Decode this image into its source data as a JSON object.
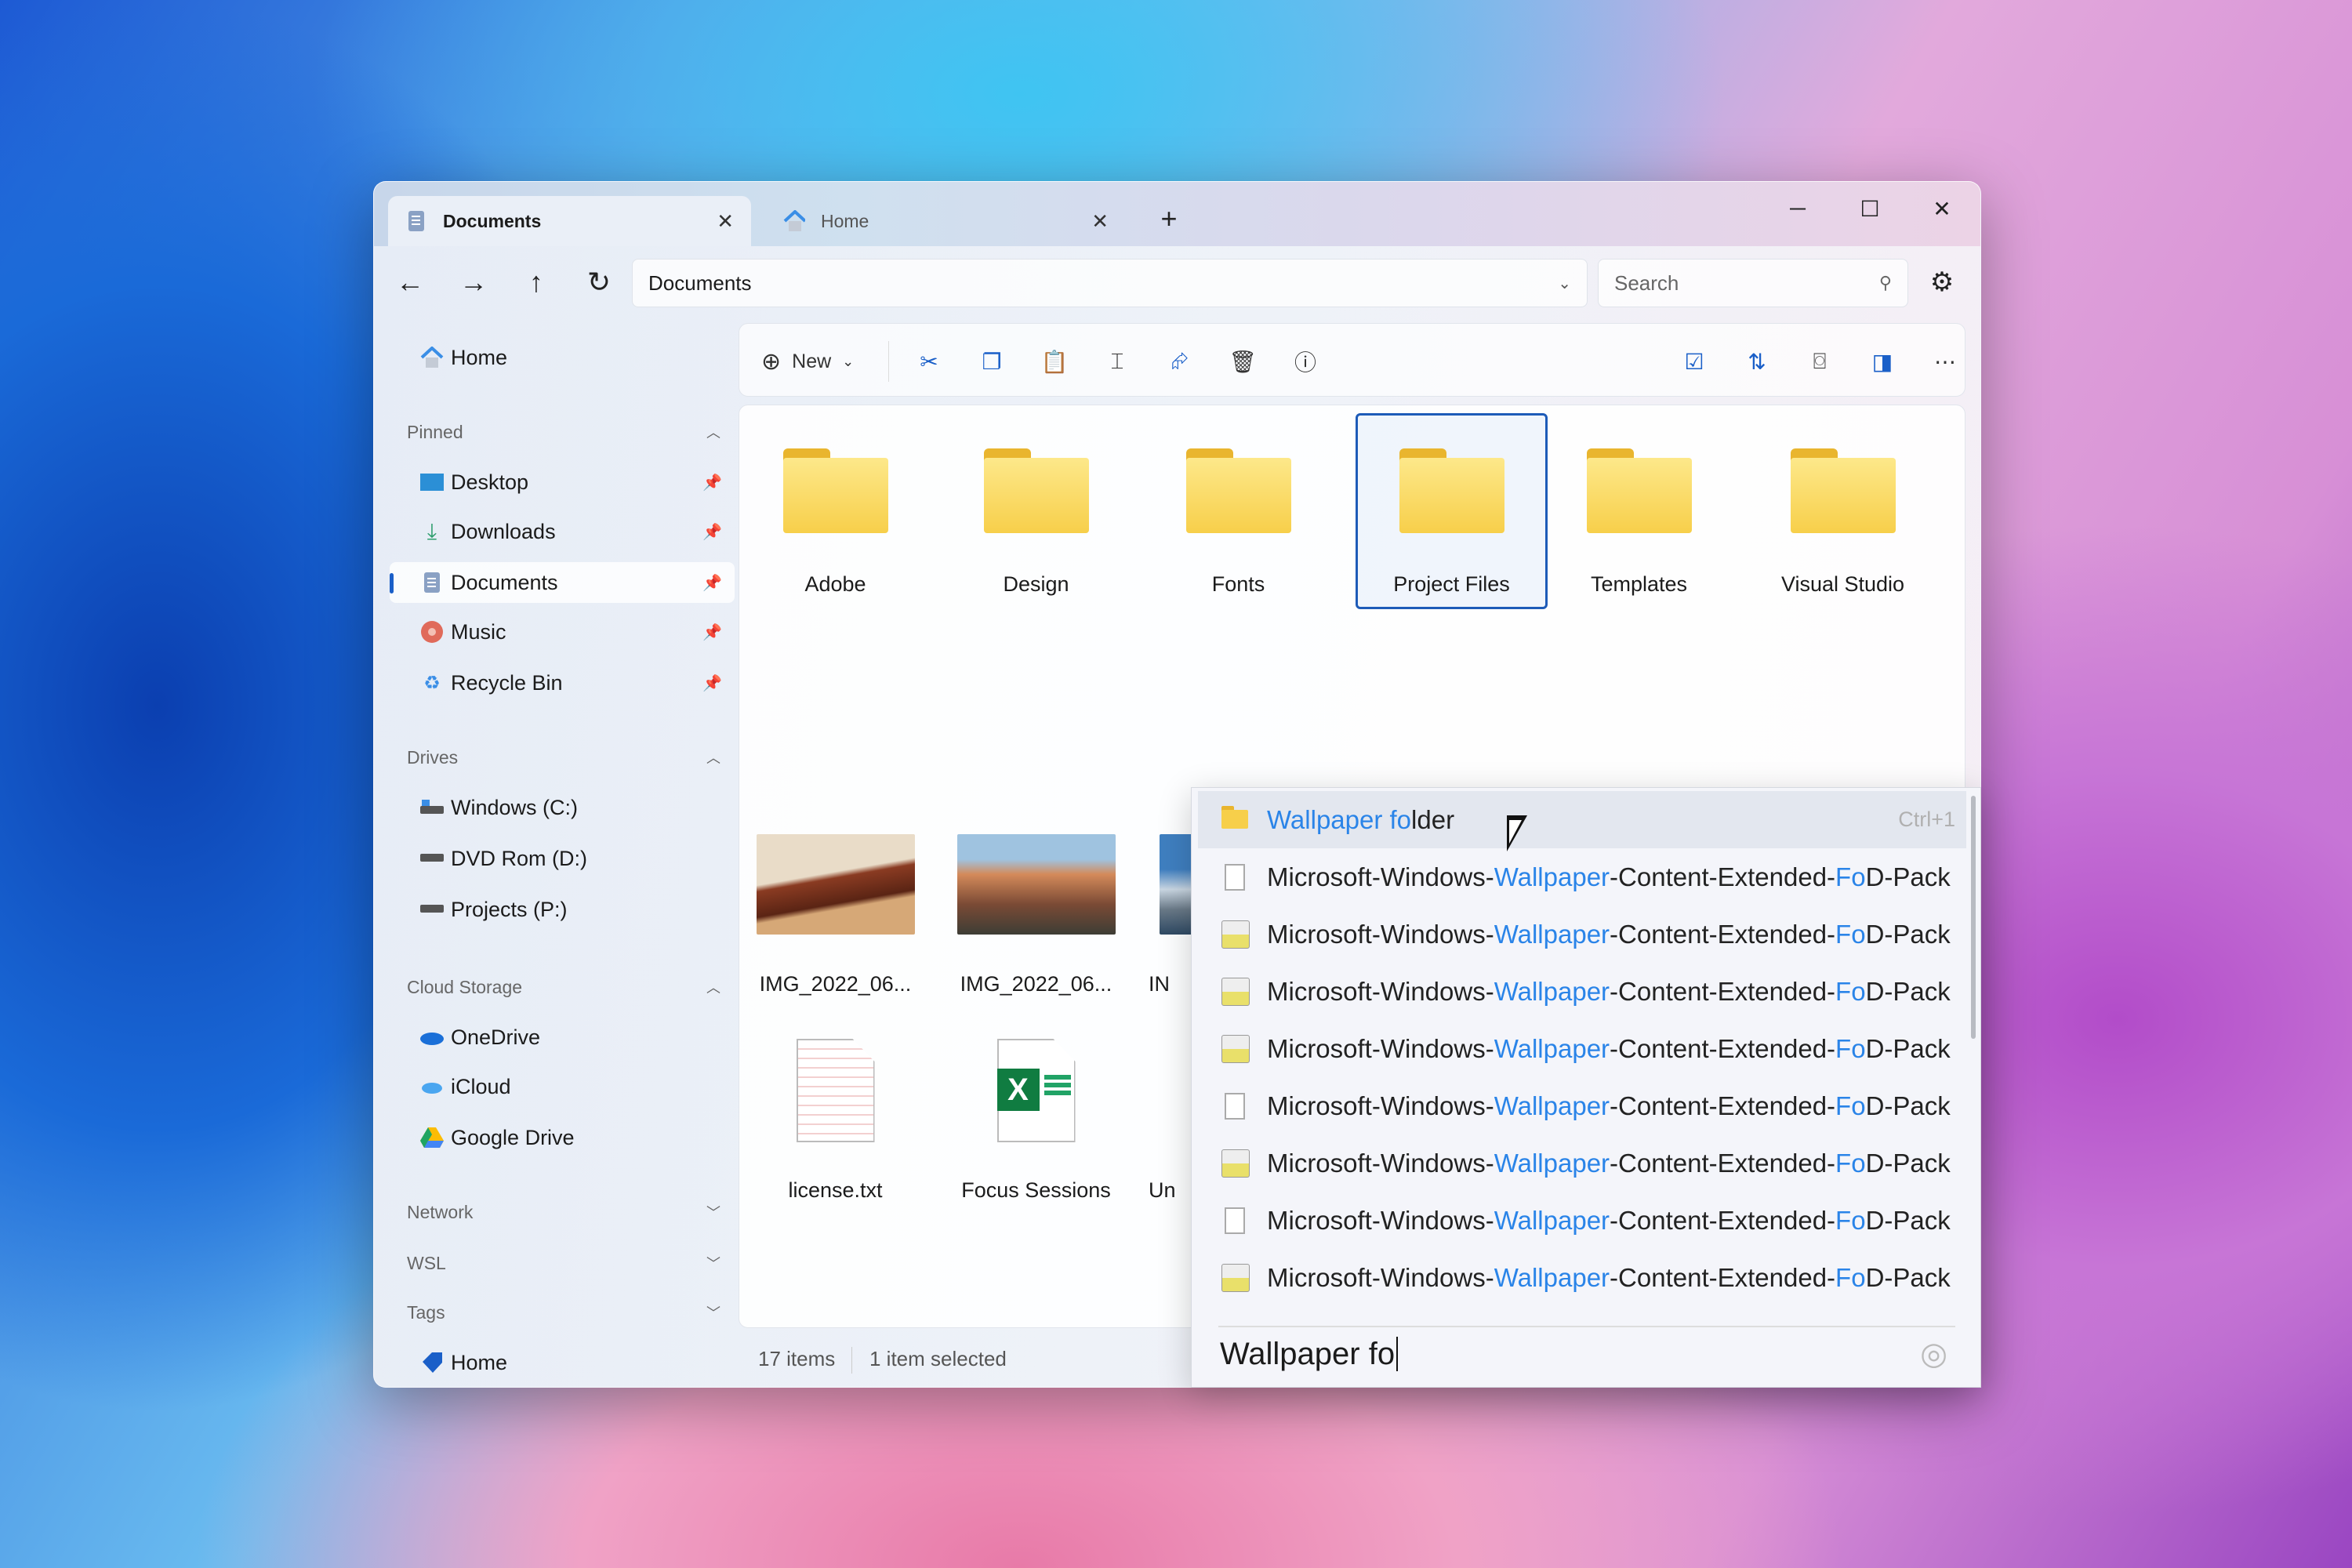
{
  "tabs": [
    {
      "label": "Documents",
      "icon": "documents-icon",
      "active": true
    },
    {
      "label": "Home",
      "icon": "home-icon",
      "active": false
    }
  ],
  "window_controls": {
    "minimize": "─",
    "maximize": "☐",
    "close": "✕",
    "new_tab": "+"
  },
  "nav": {
    "back": "←",
    "forward": "→",
    "up": "↑",
    "refresh": "↻"
  },
  "address": {
    "path": "Documents"
  },
  "search": {
    "placeholder": "Search"
  },
  "toolbar": {
    "new_label": "New",
    "buttons": [
      "cut-icon",
      "copy-icon",
      "paste-icon",
      "rename-icon",
      "share-icon",
      "delete-icon",
      "info-icon",
      "select-icon",
      "sort-icon",
      "preview-icon",
      "details-pane-icon",
      "more-icon"
    ]
  },
  "sidebar": {
    "home": "Home",
    "sections": {
      "pinned": "Pinned",
      "drives": "Drives",
      "cloud": "Cloud Storage",
      "network": "Network",
      "wsl": "WSL",
      "tags": "Tags"
    },
    "pinned": [
      {
        "label": "Desktop"
      },
      {
        "label": "Downloads"
      },
      {
        "label": "Documents",
        "selected": true
      },
      {
        "label": "Music"
      },
      {
        "label": "Recycle Bin"
      }
    ],
    "drives": [
      {
        "label": "Windows (C:)"
      },
      {
        "label": "DVD Rom (D:)"
      },
      {
        "label": "Projects (P:)"
      }
    ],
    "cloud": [
      {
        "label": "OneDrive"
      },
      {
        "label": "iCloud"
      },
      {
        "label": "Google Drive"
      }
    ],
    "tags": [
      {
        "label": "Home",
        "color": "#1a5fc8"
      }
    ]
  },
  "files": {
    "folders": [
      "Adobe",
      "Design",
      "Fonts",
      "Project Files",
      "Templates",
      "Visual Studio"
    ],
    "selected": "Project Files",
    "row2": [
      "IMG_2022_06...",
      "IMG_2022_06...",
      "IN"
    ],
    "row3": [
      "license.txt",
      "Focus Sessions",
      "Un"
    ]
  },
  "status": {
    "items": "17 items",
    "selected": "1 item selected"
  },
  "suggestions": {
    "top": {
      "match": "Wallpaper fo",
      "rest": "lder",
      "shortcut": "Ctrl+1"
    },
    "items": [
      {
        "icon": "file",
        "a": "Microsoft-Windows-",
        "b": "Wallpaper",
        "c": "-Content-Extended-",
        "d": "Fo",
        "e": "D-Pack"
      },
      {
        "icon": "package",
        "a": "Microsoft-Windows-",
        "b": "Wallpaper",
        "c": "-Content-Extended-",
        "d": "Fo",
        "e": "D-Pack"
      },
      {
        "icon": "package",
        "a": "Microsoft-Windows-",
        "b": "Wallpaper",
        "c": "-Content-Extended-",
        "d": "Fo",
        "e": "D-Pack"
      },
      {
        "icon": "package",
        "a": "Microsoft-Windows-",
        "b": "Wallpaper",
        "c": "-Content-Extended-",
        "d": "Fo",
        "e": "D-Pack"
      },
      {
        "icon": "file",
        "a": "Microsoft-Windows-",
        "b": "Wallpaper",
        "c": "-Content-Extended-",
        "d": "Fo",
        "e": "D-Pack"
      },
      {
        "icon": "package",
        "a": "Microsoft-Windows-",
        "b": "Wallpaper",
        "c": "-Content-Extended-",
        "d": "Fo",
        "e": "D-Pack"
      },
      {
        "icon": "file",
        "a": "Microsoft-Windows-",
        "b": "Wallpaper",
        "c": "-Content-Extended-",
        "d": "Fo",
        "e": "D-Pack"
      },
      {
        "icon": "package",
        "a": "Microsoft-Windows-",
        "b": "Wallpaper",
        "c": "-Content-Extended-",
        "d": "Fo",
        "e": "D-Pack"
      }
    ],
    "query": "Wallpaper fo"
  },
  "colors": {
    "accent": "#1a5fc8",
    "highlight": "#2a84e8",
    "folder": "#f7cf4a"
  }
}
